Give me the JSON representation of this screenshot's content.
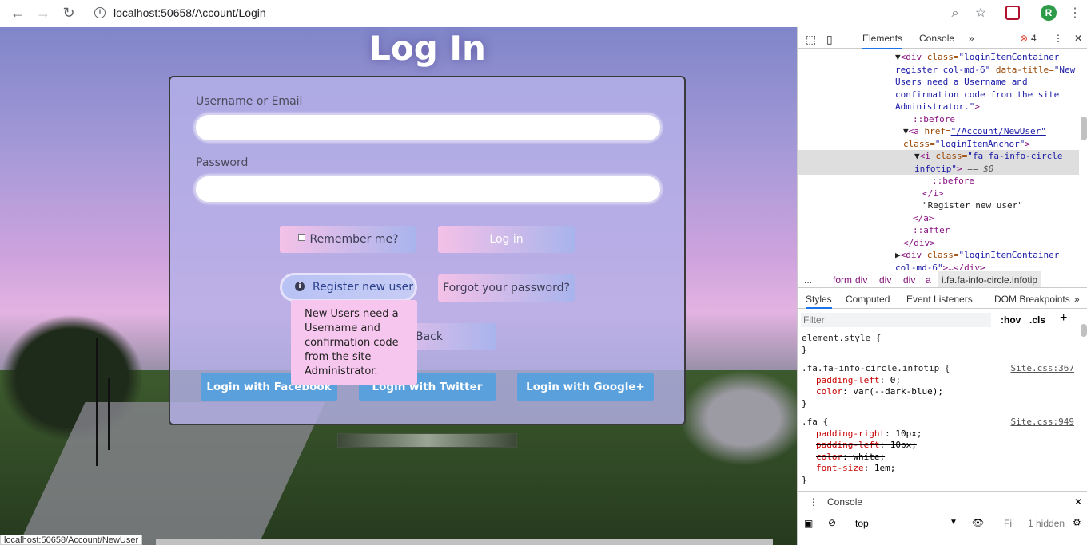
{
  "browser": {
    "url": "localhost:50658/Account/Login",
    "avatar_letter": "R"
  },
  "login": {
    "title": "Log In",
    "username_label": "Username or Email",
    "password_label": "Password",
    "remember_label": "Remember me?",
    "login_button": "Log in",
    "register_button": "Register new user",
    "forgot_button": "Forgot your password?",
    "back_button": "Back",
    "tooltip": "New Users need a Username and confirmation code from the site Administrator.",
    "facebook_button": "Login with Facebook",
    "twitter_button": "Login with Twitter",
    "google_button": "Login with Google+"
  },
  "status_bar": "localhost:50658/Account/NewUser",
  "devtools": {
    "tabs": [
      "Elements",
      "Console"
    ],
    "error_count": "4",
    "breadcrumbs": [
      "...",
      "form",
      "div",
      "div",
      "div",
      "a",
      "i.fa.fa-info-circle.infotip"
    ],
    "styles_tabs": [
      "Styles",
      "Computed",
      "Event Listeners",
      "DOM Breakpoints"
    ],
    "filter_placeholder": "Filter",
    "hov": ":hov",
    "cls": ".cls",
    "dom_lines": [
      {
        "indent": "▼",
        "t1": "<div ",
        "a1": "class=",
        "v1": "\"loginItemContainer"
      },
      {
        "indent": "",
        "t1": "",
        "a1": "",
        "v1": "register col-md-6\" ",
        "a2": "data-title=",
        "v2": "\"New"
      },
      {
        "indent": "",
        "v1": "Users need a Username and"
      },
      {
        "indent": "",
        "v1": "confirmation code from the site"
      },
      {
        "indent": "",
        "v1": "Administrator.\"",
        "t2": ">"
      },
      {
        "pse": "::before"
      },
      {
        "indent": "▼",
        "t1": "<a ",
        "a1": "href=",
        "link": "\"/Account/NewUser\""
      },
      {
        "a1": "class=",
        "v1": "\"loginItemAnchor\"",
        "t2": ">"
      },
      {
        "indent": "▼",
        "t1": "<i ",
        "a1": "class=",
        "v1": "\"fa fa-info-circle"
      },
      {
        "v1": "infotip\"",
        "t2": ">",
        "eq": " == $0"
      },
      {
        "pse": "::before"
      },
      {
        "t1": "</i>"
      },
      {
        "txt": "\"Register new user\""
      },
      {
        "t1": "</a>"
      },
      {
        "pse": "::after"
      },
      {
        "t1": "</div>"
      },
      {
        "indent": "▶",
        "t1": "<div ",
        "a1": "class=",
        "v1": "\"loginItemContainer"
      },
      {
        "v1": "col-md-6\"",
        "t2": ">…</div>"
      }
    ],
    "css_rules": [
      {
        "selector": "element.style {",
        "source": ""
      },
      {
        "close": "}"
      },
      {
        "selector": ".fa.fa-info-circle.infotip {",
        "source": "Site.css:367"
      },
      {
        "prop": "padding-left",
        "val": "0;"
      },
      {
        "prop": "color",
        "val": "var(--dark-blue);"
      },
      {
        "close": "}"
      },
      {
        "selector": ".fa {",
        "source": "Site.css:949"
      },
      {
        "prop": "padding-right",
        "val": "10px;"
      },
      {
        "prop": "padding-left",
        "val": "10px;",
        "struck": true
      },
      {
        "prop": "color",
        "val": "white;",
        "struck": true
      },
      {
        "prop": "font-size",
        "val": "1em;"
      },
      {
        "close": "}"
      }
    ],
    "console_tab": "Console",
    "context": "top",
    "console_filter": "Fi",
    "hidden_count": "1 hidden"
  }
}
